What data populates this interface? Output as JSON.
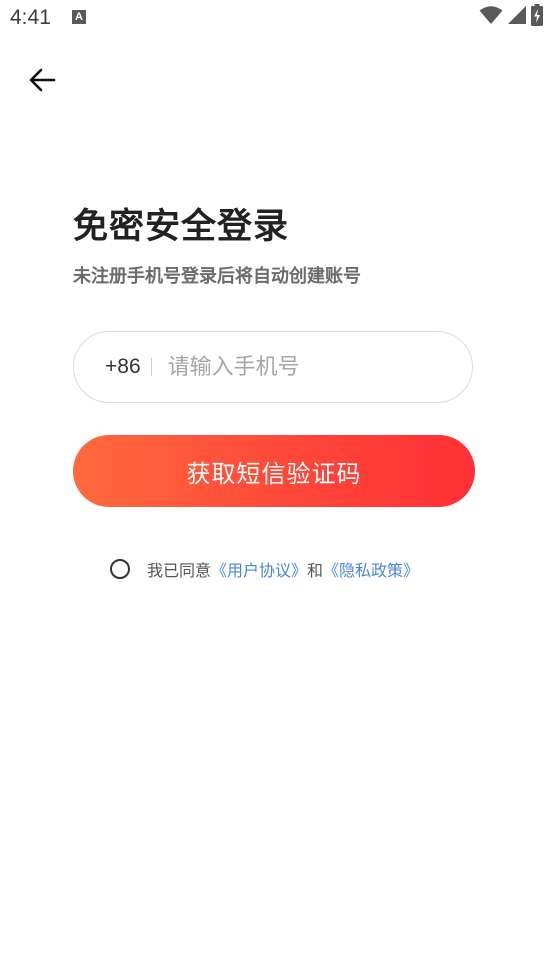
{
  "status_bar": {
    "time": "4:41",
    "notification_icon_letter": "A",
    "icons": [
      "wifi-icon",
      "cellular-signal-icon",
      "battery-charging-icon"
    ]
  },
  "navigation": {
    "back_icon": "arrow-left-icon"
  },
  "header": {
    "title": "免密安全登录",
    "subtitle": "未注册手机号登录后将自动创建账号"
  },
  "phone_field": {
    "country_code": "+86",
    "value": "",
    "placeholder": "请输入手机号"
  },
  "submit_button": {
    "label": "获取短信验证码"
  },
  "agreement": {
    "checked": false,
    "prefix": "我已同意",
    "user_agreement": "《用户协议》",
    "conjunction": "和",
    "privacy_policy": "《隐私政策》"
  },
  "colors": {
    "accent_start": "#ff6a3d",
    "accent_end": "#ff2f36",
    "link": "#4a86d8",
    "title": "#222222",
    "subtitle": "#6b6b6b"
  }
}
